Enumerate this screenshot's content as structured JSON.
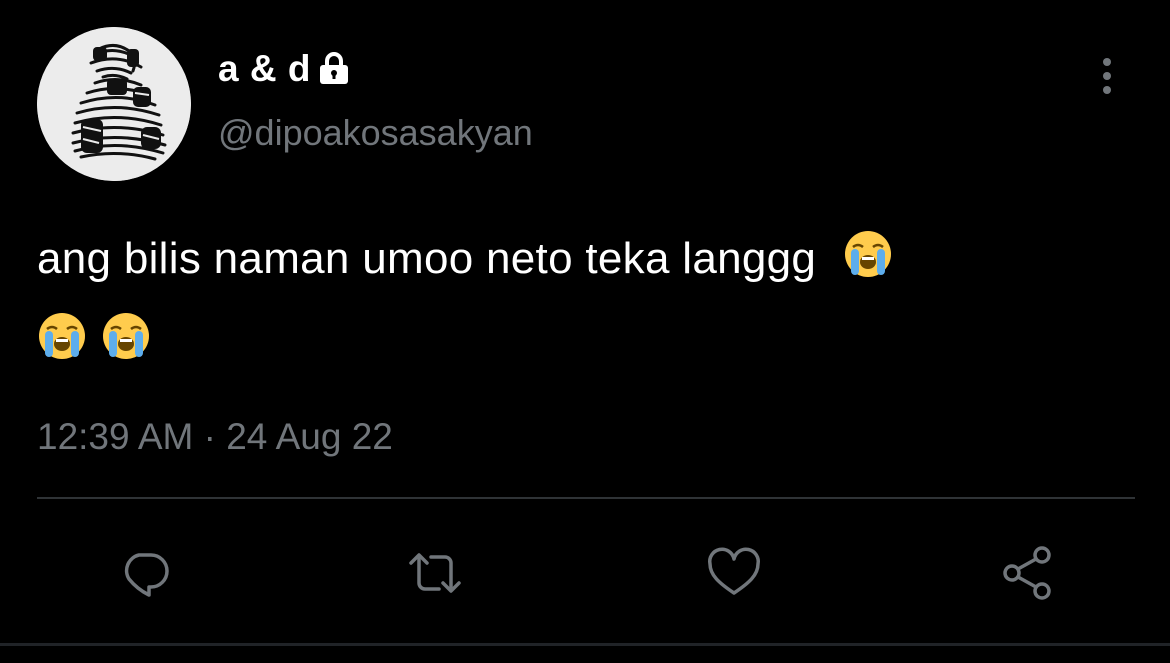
{
  "user": {
    "display_name": "a & d",
    "handle": "@dipoakosasakyan",
    "protected_icon": "lock-icon"
  },
  "tweet": {
    "text": "ang bilis naman umoo neto teka langgg",
    "emoji": [
      "loudly-crying-face",
      "loudly-crying-face",
      "loudly-crying-face"
    ],
    "timestamp": "12:39 AM · 24 Aug 22"
  },
  "actions": [
    {
      "name": "reply",
      "icon": "reply-icon"
    },
    {
      "name": "retweet",
      "icon": "retweet-icon"
    },
    {
      "name": "like",
      "icon": "heart-icon"
    },
    {
      "name": "share",
      "icon": "share-icon"
    }
  ],
  "colors": {
    "background": "#000000",
    "primary_text": "#ffffff",
    "secondary_text": "#71767b",
    "divider": "#2f3336"
  }
}
